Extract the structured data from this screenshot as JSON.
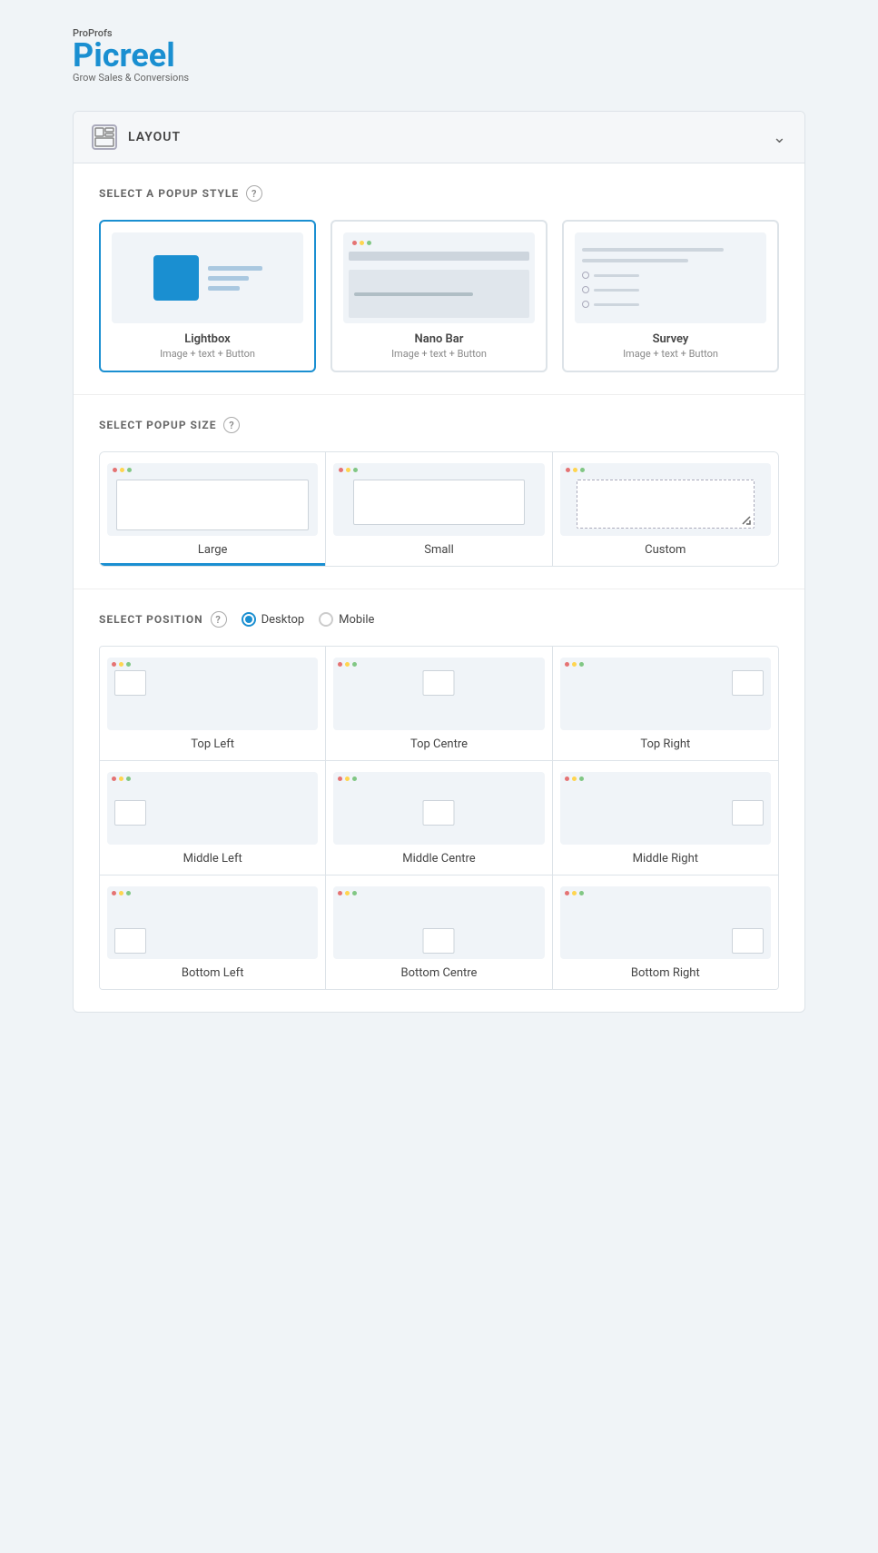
{
  "brand": {
    "proprofs": "ProProfs",
    "name": "Picreel",
    "tagline": "Grow Sales & Conversions"
  },
  "layout": {
    "title": "LAYOUT",
    "chevron": "⌄"
  },
  "popup_style": {
    "section_title": "SELECT A POPUP STYLE",
    "cards": [
      {
        "id": "lightbox",
        "name": "Lightbox",
        "desc": "Image + text + Button",
        "selected": true
      },
      {
        "id": "nanobar",
        "name": "Nano Bar",
        "desc": "Image + text + Button",
        "selected": false
      },
      {
        "id": "survey",
        "name": "Survey",
        "desc": "Image + text + Button",
        "selected": false
      }
    ]
  },
  "popup_size": {
    "section_title": "SELECT POPUP SIZE",
    "cards": [
      {
        "id": "large",
        "label": "Large",
        "selected": true
      },
      {
        "id": "small",
        "label": "Small",
        "selected": false
      },
      {
        "id": "custom",
        "label": "Custom",
        "selected": false
      }
    ]
  },
  "position": {
    "section_title": "SELECT POSITION",
    "device_options": [
      {
        "id": "desktop",
        "label": "Desktop",
        "selected": true
      },
      {
        "id": "mobile",
        "label": "Mobile",
        "selected": false
      }
    ],
    "grid": [
      [
        {
          "id": "top-left",
          "label": "Top Left"
        },
        {
          "id": "top-centre",
          "label": "Top Centre"
        },
        {
          "id": "top-right",
          "label": "Top Right"
        }
      ],
      [
        {
          "id": "middle-left",
          "label": "Middle Left"
        },
        {
          "id": "middle-centre",
          "label": "Middle Centre"
        },
        {
          "id": "middle-right",
          "label": "Middle Right"
        }
      ],
      [
        {
          "id": "bottom-left",
          "label": "Bottom Left"
        },
        {
          "id": "bottom-centre",
          "label": "Bottom Centre"
        },
        {
          "id": "bottom-right",
          "label": "Bottom Right"
        }
      ]
    ]
  }
}
